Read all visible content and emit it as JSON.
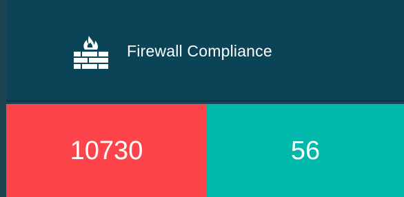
{
  "widget": {
    "title": "Firewall Compliance",
    "icon": "firewall-icon"
  },
  "metrics": [
    {
      "value": "10730",
      "color": "#fd444b",
      "status": "non-compliant"
    },
    {
      "value": "56",
      "color": "#00b8a9",
      "status": "compliant"
    }
  ],
  "colors": {
    "background": "#1d4452",
    "header": "#0b4457",
    "text": "#ffffff"
  }
}
